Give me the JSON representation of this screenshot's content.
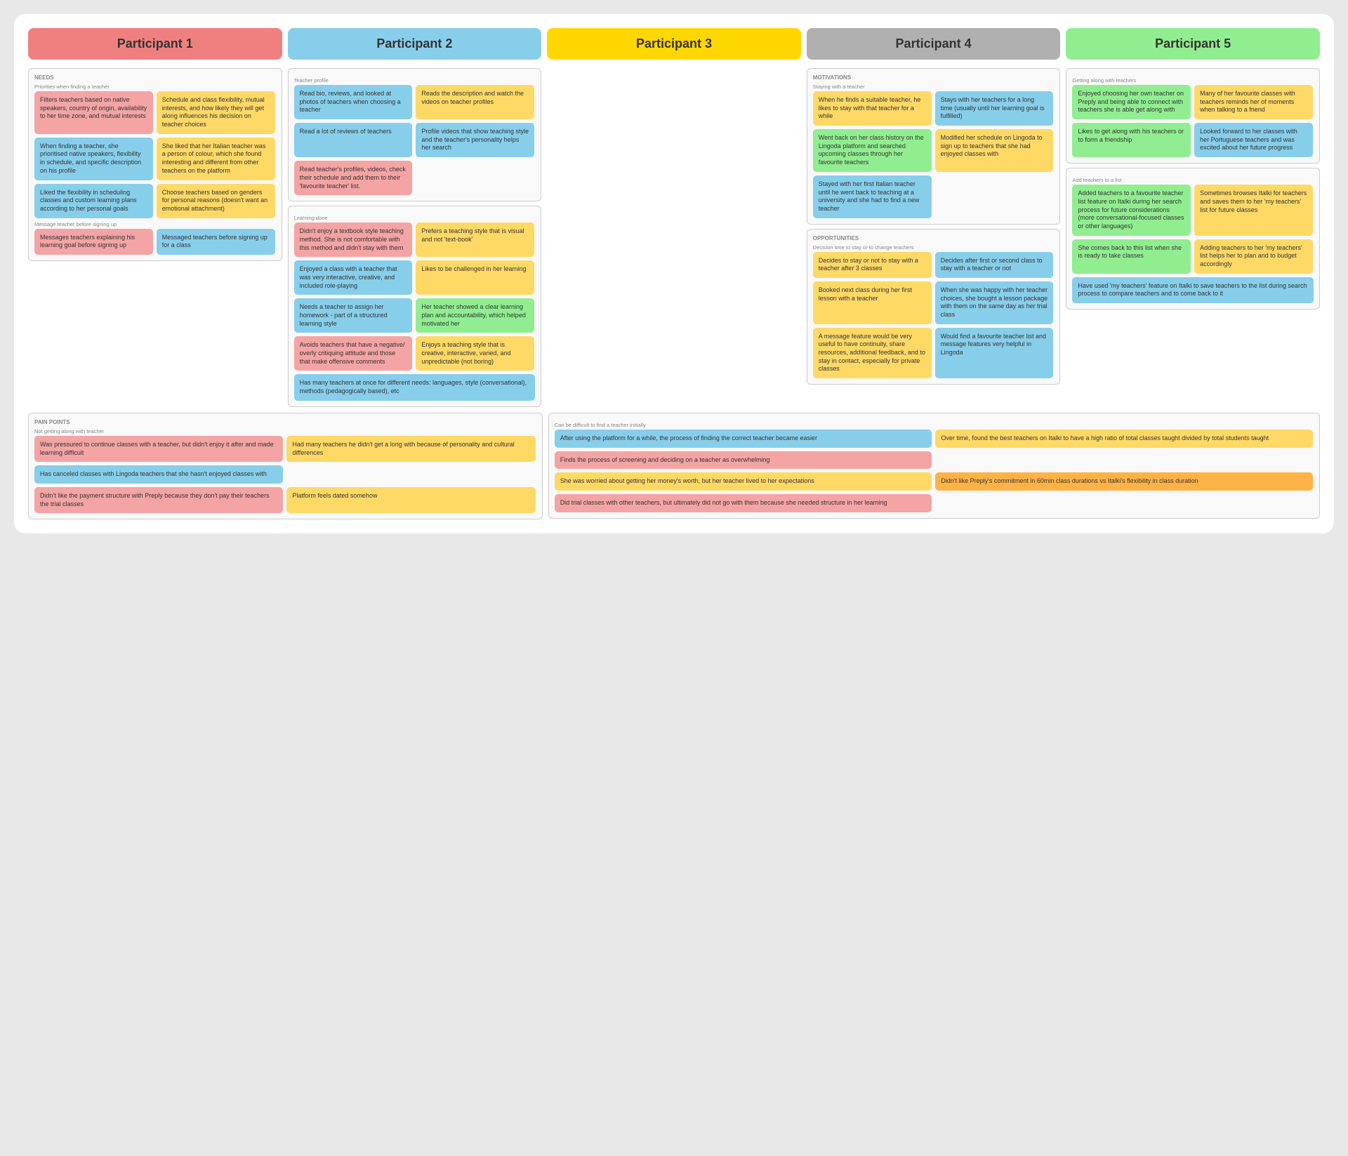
{
  "participants": [
    {
      "label": "Participant 1",
      "headerClass": "p1-header"
    },
    {
      "label": "Participant 2",
      "headerClass": "p2-header"
    },
    {
      "label": "Participant 3",
      "headerClass": "p3-header"
    },
    {
      "label": "Participant 4",
      "headerClass": "p4-header"
    },
    {
      "label": "Participant 5",
      "headerClass": "p5-header"
    }
  ],
  "p1": {
    "needs_label": "NEEDS",
    "priorities_label": "Priorities when finding a teacher",
    "needs_cards": [
      {
        "text": "Filters teachers based on native speakers, country of origin, availability to her time zone, and mutual interests",
        "color": "card-pink"
      },
      {
        "text": "Schedule and class flexibility, mutual interests, and how likely they will get along influences his decision on teacher choices",
        "color": "card-yellow"
      },
      {
        "text": "When finding a teacher, she prioritised native speakers, flexibility in schedule, and specific description on his profile",
        "color": "card-blue"
      },
      {
        "text": "She liked that her Italian teacher was a person of colour, which she found interesting and different from other teachers on the platform",
        "color": "card-yellow"
      },
      {
        "text": "Liked the flexibility in scheduling classes and custom learning plans according to her personal goals",
        "color": "card-blue"
      },
      {
        "text": "Choose teachers based on genders for personal reasons (doesn't want an emotional attachment)",
        "color": "card-yellow"
      }
    ],
    "message_label": "Message teacher before signing up",
    "message_cards": [
      {
        "text": "Messages teachers explaining his learning goal before signing up",
        "color": "card-pink"
      },
      {
        "text": "Messaged teachers before signing up for a class",
        "color": "card-blue"
      }
    ],
    "pain_label": "PAIN POINTS",
    "pain_sub1": "Not getting along with teacher",
    "pain_cards1": [
      {
        "text": "Was pressured to continue classes with a teacher, but didn't enjoy it after and made learning difficult",
        "color": "card-pink"
      },
      {
        "text": "Had many teachers he didn't get a long with because of personality and cultural differences",
        "color": "card-yellow"
      },
      {
        "text": "Has canceled classes with Lingoda teachers that she hasn't enjoyed classes with",
        "color": "card-blue"
      }
    ],
    "pain_cards2": [
      {
        "text": "Didn't like the payment structure with Preply because they don't pay their teachers the trial classes",
        "color": "card-pink"
      },
      {
        "text": "Platform feels dated somehow",
        "color": "card-yellow"
      }
    ]
  },
  "p2": {
    "teacher_profile_label": "Teacher profile",
    "tp_cards": [
      {
        "text": "Read bio, reviews, and looked at photos of teachers when choosing a teacher",
        "color": "card-blue"
      },
      {
        "text": "Reads the description and watch the videos on teacher profiles",
        "color": "card-yellow"
      },
      {
        "text": "Read a lot of reviews of teachers",
        "color": "card-blue"
      },
      {
        "text": "Profile videos that show teaching style and the teacher's personality helps her search",
        "color": "card-blue"
      },
      {
        "text": "Read teacher's profiles, videos, check their schedule and add them to their 'favourite teacher' list.",
        "color": "card-pink"
      }
    ],
    "learning_label": "Learning done",
    "learn_cards": [
      {
        "text": "Didn't enjoy a textbook style teaching method. She is not comfortable with this method and didn't stay with them",
        "color": "card-pink"
      },
      {
        "text": "Prefers a teaching style that is visual and not 'text-book'",
        "color": "card-yellow"
      },
      {
        "text": "Enjoyed a class with a teacher that was very interactive, creative, and included role-playing",
        "color": "card-blue"
      },
      {
        "text": "Likes to be challenged in her learning",
        "color": "card-yellow"
      },
      {
        "text": "Needs a teacher to assign her homework - part of a structured learning style",
        "color": "card-blue"
      },
      {
        "text": "Her teacher showed a clear learning plan and accountability, which helped motivated her",
        "color": "card-green"
      },
      {
        "text": "Avoids teachers that have a negative/ overly critiquing attitude and those that make offensive comments",
        "color": "card-pink"
      },
      {
        "text": "Enjoys a teaching style that is creative, interactive, varied, and unpredictable (not boring)",
        "color": "card-yellow"
      },
      {
        "text": "Has many teachers at once for different needs: languages, style (conversational), methods (pedagogically based), etc",
        "color": "card-blue"
      }
    ],
    "pain_sub2": "Can be difficult to find a teacher initially",
    "pain_p2_cards": [
      {
        "text": "After using the platform for a while, the process of finding the correct teacher became easier",
        "color": "card-blue"
      },
      {
        "text": "Over time, found the best teachers on Italki to have a high ratio of total classes taught divided by total students taught",
        "color": "card-yellow"
      },
      {
        "text": "Finds the process of screening and deciding on a teacher as overwhelming",
        "color": "card-pink"
      }
    ],
    "pain_p2_cards2": [
      {
        "text": "She was worried about getting her money's worth, but her teacher lived to her expectations",
        "color": "card-yellow"
      },
      {
        "text": "Didn't like Preply's commitment in 60min class durations vs Italki's flexibility in class duration",
        "color": "card-orange"
      },
      {
        "text": "Did trial classes with other teachers, but ultimately did not go with them because she needed structure in her learning",
        "color": "card-pink"
      }
    ]
  },
  "p3": {},
  "p4": {
    "motivations_label": "MOTIVATIONS",
    "staying_label": "Staying with a teacher",
    "staying_cards": [
      {
        "text": "When he finds a suitable teacher, he likes to stay with that teacher for a while",
        "color": "card-yellow"
      },
      {
        "text": "Stays with her teachers for a long time (usually until her learning goal is fulfilled)",
        "color": "card-blue"
      },
      {
        "text": "Went back on her class history on the Lingoda platform and searched upcoming classes through her favourite teachers",
        "color": "card-green"
      },
      {
        "text": "Modified her schedule on Lingoda to sign up to teachers that she had enjoyed classes with",
        "color": "card-yellow"
      },
      {
        "text": "Stayed with her first Italian teacher until he went back to teaching at a university and she had to find a new teacher",
        "color": "card-blue"
      }
    ],
    "opps_label": "OPPORTUNITIES",
    "decision_label": "Decision time to stay or to change teachers",
    "opps_cards1": [
      {
        "text": "Decides to stay or not to stay with a teacher after 3 classes",
        "color": "card-yellow"
      },
      {
        "text": "Decides after first or second class to stay with a teacher or not",
        "color": "card-blue"
      },
      {
        "text": "Booked next class during her first lesson with a teacher",
        "color": "card-yellow"
      },
      {
        "text": "When she was happy with her teacher choices, she bought a lesson package with them on the same day as her trial class",
        "color": "card-blue"
      },
      {
        "text": "A message feature would be very useful to have continuity, share resources, additional feedback, and to stay in contact, especially for private classes",
        "color": "card-yellow"
      },
      {
        "text": "Would find a favourite teacher list and message features very helpful in Lingoda",
        "color": "card-blue"
      }
    ]
  },
  "p5": {
    "getting_along_label": "Getting along with teachers",
    "ga_cards": [
      {
        "text": "Enjoyed choosing her own teacher on Preply and being able to connect with teachers she is able get along with",
        "color": "card-green"
      },
      {
        "text": "Many of her favourite classes with teachers reminds her of moments when talking to a friend",
        "color": "card-yellow"
      },
      {
        "text": "Likes to get along with his teachers or to form a friendship",
        "color": "card-green"
      },
      {
        "text": "Looked forward to her classes with her Portuguese teachers and was excited about her future progress",
        "color": "card-blue"
      }
    ],
    "add_teachers_label": "Add teachers to a list",
    "at_cards": [
      {
        "text": "Added teachers to a favourite teacher list feature on Italki during her search process for future considerations (more conversational-focused classes or other languages)",
        "color": "card-green"
      },
      {
        "text": "Sometimes browses Italki for teachers and saves them to her 'my teachers' list for future classes",
        "color": "card-yellow"
      },
      {
        "text": "She comes back to this list when she is ready to take classes",
        "color": "card-green"
      },
      {
        "text": "Adding teachers to her 'my teachers' list helps her to plan and to budget accordingly",
        "color": "card-yellow"
      },
      {
        "text": "Have used 'my teachers' feature on Italki to save teachers to the list during search process to compare teachers and to come back to it",
        "color": "card-blue"
      }
    ]
  }
}
